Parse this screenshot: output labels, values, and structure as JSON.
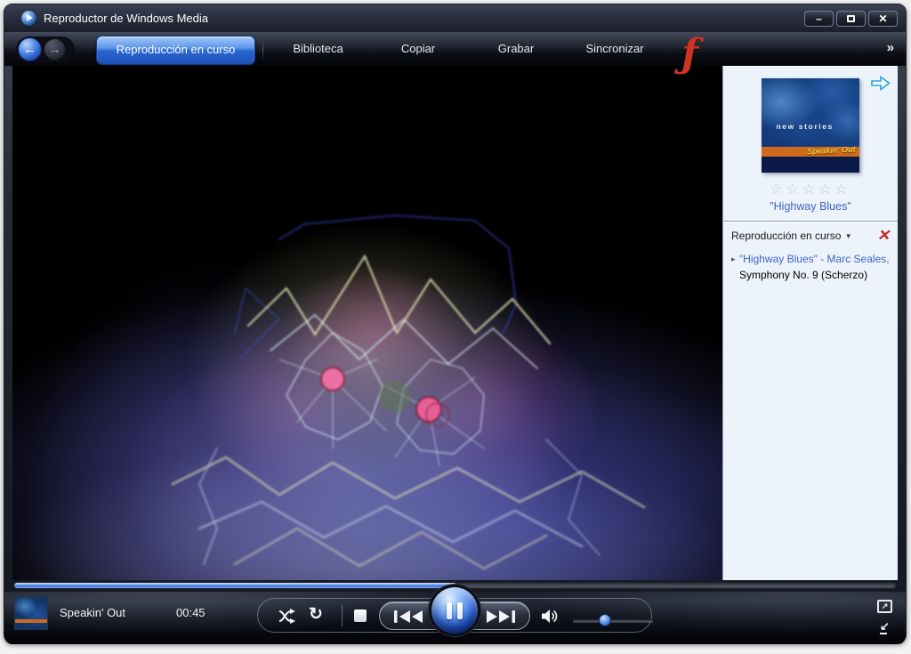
{
  "window": {
    "title": "Reproductor de Windows Media",
    "controls": {
      "minimize_glyph": "–",
      "close_glyph": "✕"
    }
  },
  "nav": {
    "back_glyph": "←",
    "forward_glyph": "→",
    "overflow_glyph": "»",
    "logo_glyph": "ƒ"
  },
  "tabs": {
    "active": {
      "label": "Reproducción en curso",
      "caret_glyph": "▾"
    },
    "items": [
      {
        "label": "Biblioteca"
      },
      {
        "label": "Copiar"
      },
      {
        "label": "Grabar"
      },
      {
        "label": "Sincronizar"
      }
    ]
  },
  "sidebar": {
    "album_art": {
      "artist_text": "new stories",
      "title_text": "Speakin' Out"
    },
    "rating": {
      "stars_glyphs": "☆☆☆☆☆",
      "max_stars": 5,
      "filled_stars": 0
    },
    "caption": "\"Highway Blues\"",
    "playlist": {
      "header_label": "Reproducción en curso",
      "caret_glyph": "▾",
      "clear_glyph": "✕",
      "tracks": [
        {
          "marker_glyph": "▸",
          "title": "\"Highway Blues\" - Marc Seales,...",
          "active": true
        },
        {
          "marker_glyph": "",
          "title": "Symphony No. 9 (Scherzo)",
          "active": false
        }
      ]
    }
  },
  "transport": {
    "now_playing_title": "Speakin' Out",
    "elapsed_time": "00:45",
    "progress_pct": 50,
    "volume_pct": 40,
    "repeat_glyph": "↻",
    "fullscreen_glyph": "↗",
    "compact_glyph": "↙"
  },
  "colors": {
    "accent_blue": "#2e63c8",
    "panel_bg": "#edf3fb",
    "logo_red": "#cc3520",
    "clear_red": "#c3271b",
    "link_blue": "#3e63c4"
  }
}
